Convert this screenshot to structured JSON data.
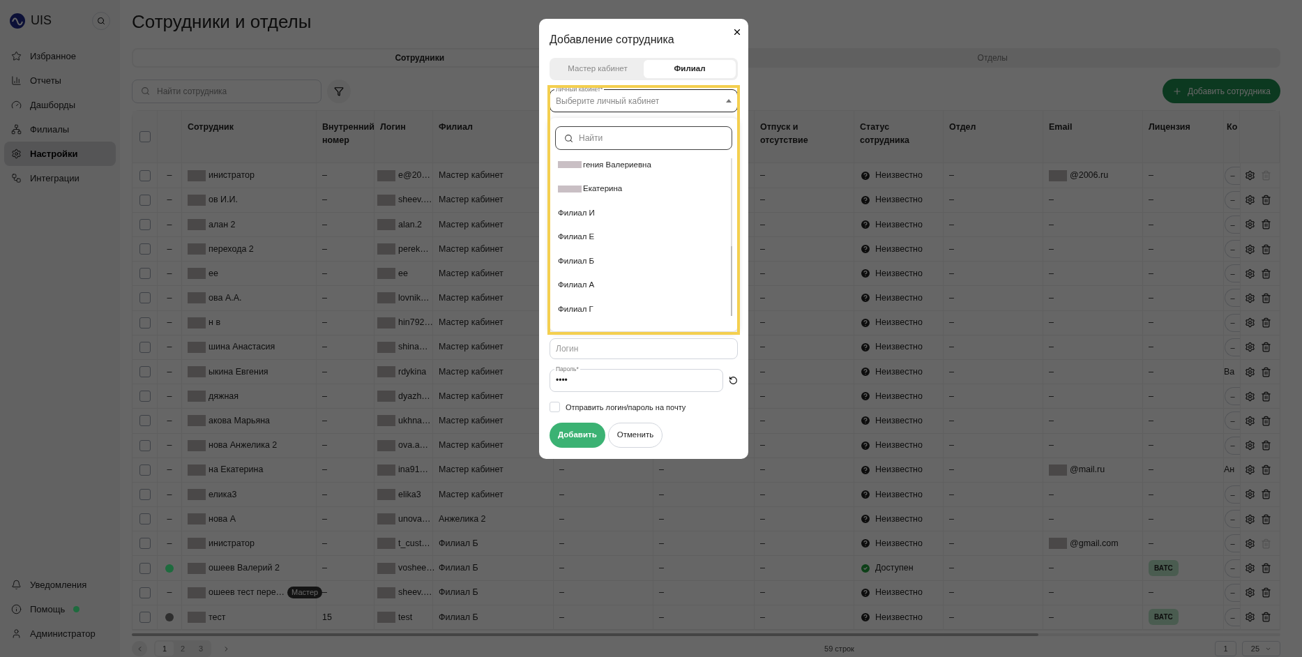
{
  "sidebar": {
    "logo": "UIS",
    "items": [
      {
        "label": "Избранное",
        "selected": false
      },
      {
        "label": "Отчеты",
        "selected": false
      },
      {
        "label": "Дашборды",
        "selected": false
      },
      {
        "label": "Филиалы",
        "selected": false
      },
      {
        "label": "Настройки",
        "selected": true
      },
      {
        "label": "Интеграции",
        "selected": false
      }
    ],
    "bottom_items": [
      {
        "label": "Уведомления"
      },
      {
        "label": "Помощь",
        "color": "#1e6b3e"
      },
      {
        "label": "Администратор"
      }
    ]
  },
  "page_title": "Сотрудники и отделы",
  "tabs": [
    {
      "label": "Сотрудники",
      "selected": true
    },
    {
      "label": "Отделы",
      "selected": false
    }
  ],
  "search": {
    "placeholder": "Найти сотрудника"
  },
  "add_button": "Добавить сотрудника",
  "table": {
    "select_all_checked": false,
    "columns": [
      "Сотрудник",
      "Внутренний номер",
      "Логин",
      "Филиал",
      "",
      "",
      "Отпуск и отсутствие",
      "Статус сотрудника",
      "Отдел",
      "Email",
      "Лицензия",
      "Ко"
    ],
    "rows": [
      {
        "checked": false,
        "indicator": {
          "kind": "dash",
          "text": "–"
        },
        "name": "инистратор",
        "ext": "–",
        "login": "e@20…",
        "branch": "Мастер кабинет",
        "column_5": "",
        "column_6": "",
        "leave": "–",
        "status": {
          "kind": "unknown",
          "text": "Неизвестно"
        },
        "dept": "–",
        "email": "@2006.ru",
        "license": {
          "kind": "text",
          "text": "–"
        },
        "column_12": {
          "kind": "button",
          "text": "–"
        },
        "deletable": false
      },
      {
        "checked": false,
        "indicator": {
          "kind": "dash",
          "text": "–"
        },
        "name": "ов И.И.",
        "ext": "–",
        "login": "sheev.…",
        "branch": "Мастер кабинет",
        "column_5": "",
        "column_6": "",
        "leave": "–",
        "status": {
          "kind": "unknown",
          "text": "Неизвестно"
        },
        "dept": "–",
        "email": "–",
        "license": {
          "kind": "text",
          "text": "–"
        },
        "column_12": {
          "kind": "button",
          "text": "–"
        },
        "deletable": true
      },
      {
        "checked": false,
        "indicator": {
          "kind": "dash",
          "text": "–"
        },
        "name": "алан 2",
        "ext": "–",
        "login": "alan.2",
        "branch": "Мастер кабинет",
        "column_5": "",
        "column_6": "",
        "leave": "–",
        "status": {
          "kind": "unknown",
          "text": "Неизвестно"
        },
        "dept": "–",
        "email": "–",
        "license": {
          "kind": "text",
          "text": "–"
        },
        "column_12": {
          "kind": "button",
          "text": "–"
        },
        "deletable": true
      },
      {
        "checked": false,
        "indicator": {
          "kind": "dash",
          "text": "–"
        },
        "name": "перехода 2",
        "ext": "–",
        "login": "perek…",
        "branch": "Мастер кабинет",
        "column_5": "",
        "column_6": "",
        "leave": "–",
        "status": {
          "kind": "unknown",
          "text": "Неизвестно"
        },
        "dept": "–",
        "email": "–",
        "license": {
          "kind": "text",
          "text": "–"
        },
        "column_12": {
          "kind": "button",
          "text": "–"
        },
        "deletable": true
      },
      {
        "checked": false,
        "indicator": {
          "kind": "dash",
          "text": "–"
        },
        "name": "ee",
        "ext": "–",
        "login": "ee",
        "branch": "Мастер кабинет",
        "column_5": "",
        "column_6": "",
        "leave": "–",
        "status": {
          "kind": "unknown",
          "text": "Неизвестно"
        },
        "dept": "–",
        "email": "–",
        "license": {
          "kind": "text",
          "text": "–"
        },
        "column_12": {
          "kind": "button",
          "text": "–"
        },
        "deletable": true
      },
      {
        "checked": false,
        "indicator": {
          "kind": "dash",
          "text": "–"
        },
        "name": "ова А.А.",
        "ext": "–",
        "login": "lovnik…",
        "branch": "Мастер кабинет",
        "column_5": "",
        "column_6": "",
        "leave": "–",
        "status": {
          "kind": "unknown",
          "text": "Неизвестно"
        },
        "dept": "–",
        "email": "–",
        "license": {
          "kind": "text",
          "text": "–"
        },
        "column_12": {
          "kind": "button",
          "text": "–"
        },
        "deletable": true
      },
      {
        "checked": false,
        "indicator": {
          "kind": "dash",
          "text": "–"
        },
        "name": "н в",
        "ext": "–",
        "login": "hin792…",
        "branch": "Мастер кабинет",
        "column_5": "",
        "column_6": "",
        "leave": "–",
        "status": {
          "kind": "unknown",
          "text": "Неизвестно"
        },
        "dept": "–",
        "email": "–",
        "license": {
          "kind": "text",
          "text": "–"
        },
        "column_12": {
          "kind": "button",
          "text": "–"
        },
        "deletable": true
      },
      {
        "checked": false,
        "indicator": {
          "kind": "dash",
          "text": "–"
        },
        "name": "шина Анастасия",
        "ext": "–",
        "login": "shina…",
        "branch": "Мастер кабинет",
        "column_5": "",
        "column_6": "",
        "leave": "–",
        "status": {
          "kind": "unknown",
          "text": "Неизвестно"
        },
        "dept": "–",
        "email": "–",
        "license": {
          "kind": "text",
          "text": "–"
        },
        "column_12": {
          "kind": "button",
          "text": "–"
        },
        "deletable": true
      },
      {
        "checked": false,
        "indicator": {
          "kind": "dash",
          "text": "–"
        },
        "name": "ыкина Евгения",
        "ext": "–",
        "login": "rdykina",
        "branch": "Мастер кабинет",
        "column_5": "",
        "column_6": "",
        "leave": "–",
        "status": {
          "kind": "unknown",
          "text": "Неизвестно"
        },
        "dept": "–",
        "email": "–",
        "license": {
          "kind": "text",
          "text": "–"
        },
        "column_12": {
          "kind": "text",
          "text": "Ва"
        },
        "deletable": true
      },
      {
        "checked": false,
        "indicator": {
          "kind": "dash",
          "text": "–"
        },
        "name": "дяжная",
        "ext": "–",
        "login": "dyazh…",
        "branch": "Мастер кабинет",
        "column_5": "",
        "column_6": "",
        "leave": "–",
        "status": {
          "kind": "unknown",
          "text": "Неизвестно"
        },
        "dept": "–",
        "email": "–",
        "license": {
          "kind": "text",
          "text": "–"
        },
        "column_12": {
          "kind": "button",
          "text": "–"
        },
        "deletable": true
      },
      {
        "checked": false,
        "indicator": {
          "kind": "dash",
          "text": "–"
        },
        "name": "акова Марьяна",
        "ext": "–",
        "login": "ukhna…",
        "branch": "Мастер кабинет",
        "column_5": "",
        "column_6": "",
        "leave": "–",
        "status": {
          "kind": "unknown",
          "text": "Неизвестно"
        },
        "dept": "–",
        "email": "–",
        "license": {
          "kind": "text",
          "text": "–"
        },
        "column_12": {
          "kind": "button",
          "text": "–"
        },
        "deletable": true
      },
      {
        "checked": false,
        "indicator": {
          "kind": "dash",
          "text": "–"
        },
        "name": "нова Анжелика 2",
        "ext": "–",
        "login": "ova.a…",
        "branch": "Мастер кабинет",
        "column_5": "",
        "column_6": "",
        "leave": "–",
        "status": {
          "kind": "unknown",
          "text": "Неизвестно"
        },
        "dept": "–",
        "email": "–",
        "license": {
          "kind": "text",
          "text": "–"
        },
        "column_12": {
          "kind": "button",
          "text": "–"
        },
        "deletable": true
      },
      {
        "checked": false,
        "indicator": {
          "kind": "dash",
          "text": "–"
        },
        "name": "на Екатерина",
        "ext": "–",
        "login": "ina91…",
        "branch": "Мастер кабинет",
        "column_5": "–",
        "column_6": "–",
        "leave": "–",
        "status": {
          "kind": "unknown",
          "text": "Неизвестно"
        },
        "dept": "–",
        "email": "@mail.ru",
        "license": {
          "kind": "text",
          "text": "–"
        },
        "column_12": {
          "kind": "text",
          "text": "Ан"
        },
        "deletable": true
      },
      {
        "checked": false,
        "indicator": {
          "kind": "dash",
          "text": "–"
        },
        "name": "елика3",
        "ext": "–",
        "login": "elika3",
        "branch": "Мастер кабинет",
        "column_5": "–",
        "column_6": "–",
        "leave": "–",
        "status": {
          "kind": "unknown",
          "text": "Неизвестно"
        },
        "dept": "–",
        "email": "–",
        "license": {
          "kind": "text",
          "text": "–"
        },
        "column_12": {
          "kind": "button",
          "text": "–"
        },
        "deletable": true
      },
      {
        "checked": false,
        "indicator": {
          "kind": "dash",
          "text": "–"
        },
        "name": "нова А",
        "ext": "–",
        "login": "unova…",
        "branch": "Анжелика 2",
        "column_5": "–",
        "column_6": "–",
        "leave": "–",
        "status": {
          "kind": "unknown",
          "text": "Неизвестно"
        },
        "dept": "–",
        "email": "–",
        "license": {
          "kind": "text",
          "text": "–"
        },
        "column_12": {
          "kind": "button",
          "text": "–"
        },
        "deletable": true
      },
      {
        "checked": false,
        "indicator": {
          "kind": "dash",
          "text": "–"
        },
        "name": "инистратор",
        "ext": "–",
        "login": "t_cust…",
        "branch": "Филиал Б",
        "column_5": "–",
        "column_6": "–",
        "leave": "–",
        "status": {
          "kind": "unknown",
          "text": "Неизвестно"
        },
        "dept": "–",
        "email": "@gmail.com",
        "license": {
          "kind": "text",
          "text": "–"
        },
        "column_12": {
          "kind": "button",
          "text": "–"
        },
        "deletable": false
      },
      {
        "checked": false,
        "indicator": {
          "kind": "dot",
          "color": "#1e6b3e"
        },
        "name": "ошеев Валерий 2",
        "ext": "–",
        "login": "voshee…",
        "branch": "Филиал Б",
        "column_5": "–",
        "column_6": "–",
        "leave": "–",
        "status": {
          "kind": "available",
          "text": "Доступен"
        },
        "dept": "–",
        "email": "–",
        "license": {
          "kind": "tag",
          "text": "ВАТС"
        },
        "column_12": {
          "kind": "button",
          "text": "–"
        },
        "deletable": true
      },
      {
        "checked": false,
        "indicator": {
          "kind": "dash",
          "text": "–"
        },
        "name": "ошеев тест пере…",
        "badge": "Мастер",
        "ext": "–",
        "login": "sheev.…",
        "branch": "Филиал Б",
        "column_5": "–",
        "column_6": "–",
        "leave": "–",
        "status": {
          "kind": "unknown",
          "text": "Неизвестно"
        },
        "dept": "–",
        "email": "–",
        "license": {
          "kind": "text",
          "text": "–"
        },
        "column_12": {
          "kind": "button",
          "text": "–"
        },
        "deletable": true
      },
      {
        "checked": false,
        "indicator": {
          "kind": "dot",
          "color": "#2e2e2e"
        },
        "name": "тест",
        "ext": "15",
        "login": "test",
        "branch": "Филиал Б",
        "column_5": "–",
        "column_6": "–",
        "leave": "–",
        "status": {
          "kind": "unknown",
          "text": "Неизвестно"
        },
        "dept": "–",
        "email": "–",
        "license": {
          "kind": "tag",
          "text": "ВАТС"
        },
        "column_12": {
          "kind": "button",
          "text": "–"
        },
        "deletable": true
      }
    ]
  },
  "pagination": {
    "pages": [
      {
        "label": "1",
        "selected": true
      },
      {
        "label": "2",
        "selected": false
      },
      {
        "label": "3",
        "selected": false
      }
    ],
    "rows_count": "59 строк",
    "page_input": "1",
    "page_size": "25"
  },
  "modal": {
    "title": "Добавление сотрудника",
    "tabs": [
      {
        "label": "Мастер кабинет",
        "selected": false
      },
      {
        "label": "Филиал",
        "selected": true
      }
    ],
    "select": {
      "label": "Личный кабинет*",
      "placeholder": "Выберите личный кабинет",
      "expanded": true
    },
    "dropdown": {
      "search_placeholder": "Найти",
      "options": [
        {
          "label": "гения Валериевна",
          "redacted": true
        },
        {
          "label": "Екатерина",
          "redacted": true
        },
        {
          "label": "Филиал И",
          "redacted": false
        },
        {
          "label": "Филиал Е",
          "redacted": false
        },
        {
          "label": "Филиал Б",
          "redacted": false
        },
        {
          "label": "Филиал А",
          "redacted": false
        },
        {
          "label": "Филиал Г",
          "redacted": false
        }
      ]
    },
    "login": {
      "placeholder": "Логин"
    },
    "password": {
      "label": "Пароль*",
      "value": "••••"
    },
    "send_checkbox": {
      "label": "Отправить логин/пароль на почту",
      "checked": false
    },
    "buttons": [
      {
        "kind": "primary",
        "label": "Добавить"
      },
      {
        "kind": "secondary",
        "label": "Отменить"
      }
    ]
  }
}
